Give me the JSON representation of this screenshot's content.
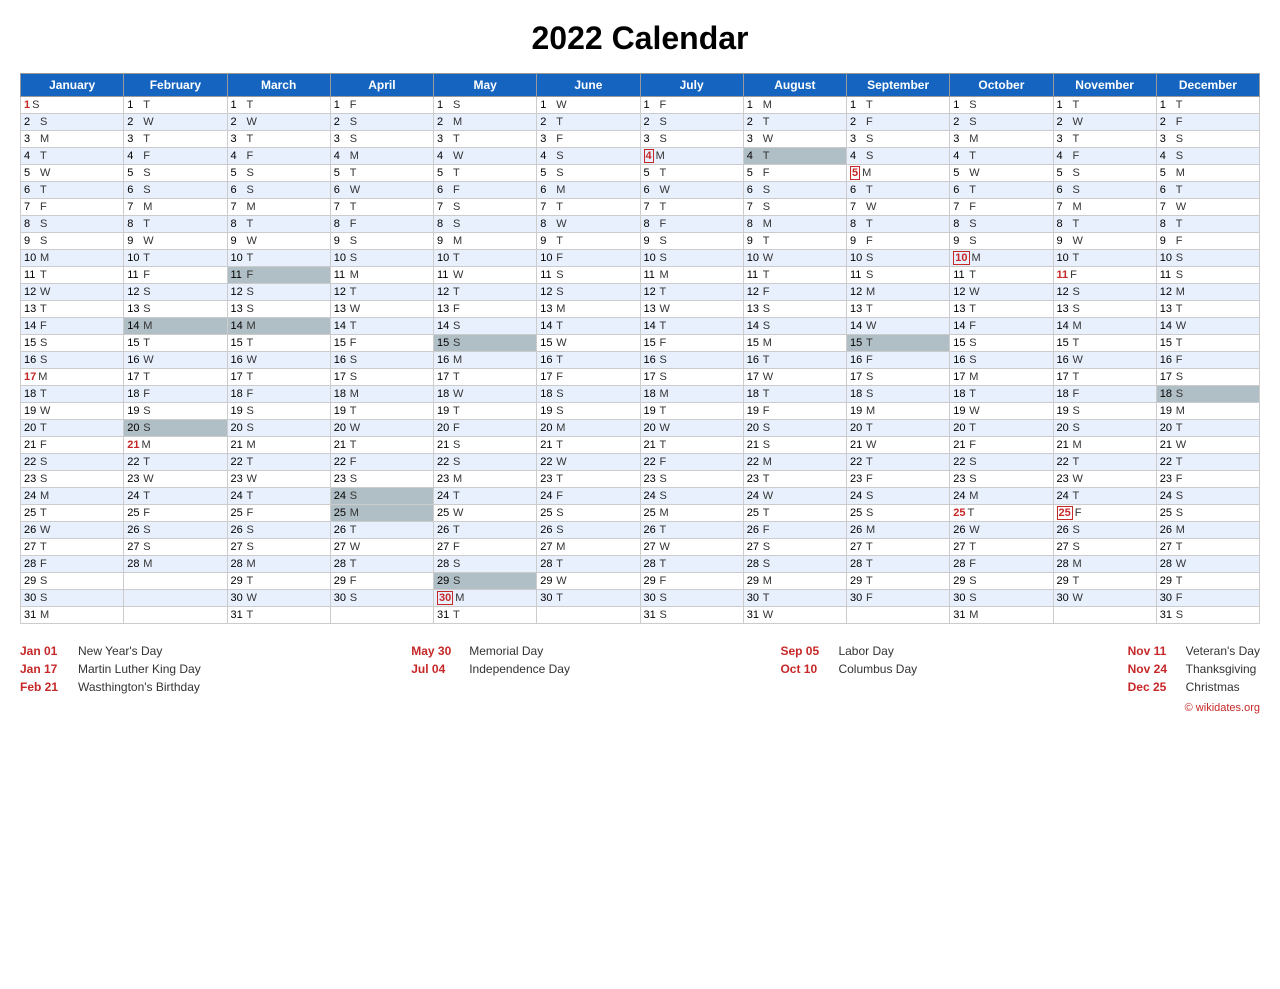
{
  "title": "2022 Calendar",
  "months": [
    "January",
    "February",
    "March",
    "April",
    "May",
    "June",
    "July",
    "August",
    "September",
    "October",
    "November",
    "December"
  ],
  "rows": [
    [
      "1 S",
      "1 T",
      "1 T",
      "1 F",
      "1 S",
      "1 W",
      "1 F",
      "1 M",
      "1 T",
      "1 S",
      "1 T",
      "1 T"
    ],
    [
      "2 S",
      "2 W",
      "2 W",
      "2 S",
      "2 M",
      "2 T",
      "2 S",
      "2 T",
      "2 F",
      "2 S",
      "2 W",
      "2 F"
    ],
    [
      "3 M",
      "3 T",
      "3 T",
      "3 S",
      "3 T",
      "3 F",
      "3 S",
      "3 W",
      "3 S",
      "3 M",
      "3 T",
      "3 S"
    ],
    [
      "4 T",
      "4 F",
      "4 F",
      "4 M",
      "4 W",
      "4 S",
      "4 M",
      "4 T",
      "4 S",
      "4 T",
      "4 F",
      "4 S"
    ],
    [
      "5 W",
      "5 S",
      "5 S",
      "5 T",
      "5 T",
      "5 S",
      "5 T",
      "5 F",
      "5 M",
      "5 W",
      "5 S",
      "5 M"
    ],
    [
      "6 T",
      "6 S",
      "6 S",
      "6 W",
      "6 F",
      "6 M",
      "6 W",
      "6 S",
      "6 T",
      "6 T",
      "6 S",
      "6 T"
    ],
    [
      "7 F",
      "7 M",
      "7 M",
      "7 T",
      "7 S",
      "7 T",
      "7 T",
      "7 S",
      "7 W",
      "7 F",
      "7 M",
      "7 W"
    ],
    [
      "8 S",
      "8 T",
      "8 T",
      "8 F",
      "8 S",
      "8 W",
      "8 F",
      "8 M",
      "8 T",
      "8 S",
      "8 T",
      "8 T"
    ],
    [
      "9 S",
      "9 W",
      "9 W",
      "9 S",
      "9 M",
      "9 T",
      "9 S",
      "9 T",
      "9 F",
      "9 S",
      "9 W",
      "9 F"
    ],
    [
      "10 M",
      "10 T",
      "10 T",
      "10 S",
      "10 T",
      "10 F",
      "10 S",
      "10 W",
      "10 S",
      "10 M",
      "10 T",
      "10 S"
    ],
    [
      "11 T",
      "11 F",
      "11 F",
      "11 M",
      "11 W",
      "11 S",
      "11 M",
      "11 T",
      "11 S",
      "11 T",
      "11 F",
      "11 S"
    ],
    [
      "12 W",
      "12 S",
      "12 S",
      "12 T",
      "12 T",
      "12 S",
      "12 T",
      "12 F",
      "12 M",
      "12 W",
      "12 S",
      "12 M"
    ],
    [
      "13 T",
      "13 S",
      "13 S",
      "13 W",
      "13 F",
      "13 M",
      "13 W",
      "13 S",
      "13 T",
      "13 T",
      "13 S",
      "13 T"
    ],
    [
      "14 F",
      "14 M",
      "14 M",
      "14 T",
      "14 S",
      "14 T",
      "14 T",
      "14 S",
      "14 W",
      "14 F",
      "14 M",
      "14 W"
    ],
    [
      "15 S",
      "15 T",
      "15 T",
      "15 F",
      "15 S",
      "15 W",
      "15 F",
      "15 M",
      "15 T",
      "15 S",
      "15 T",
      "15 T"
    ],
    [
      "16 S",
      "16 W",
      "16 W",
      "16 S",
      "16 M",
      "16 T",
      "16 S",
      "16 T",
      "16 F",
      "16 S",
      "16 W",
      "16 F"
    ],
    [
      "17 M",
      "17 T",
      "17 T",
      "17 S",
      "17 T",
      "17 F",
      "17 S",
      "17 W",
      "17 S",
      "17 M",
      "17 T",
      "17 S"
    ],
    [
      "18 T",
      "18 F",
      "18 F",
      "18 M",
      "18 W",
      "18 S",
      "18 M",
      "18 T",
      "18 S",
      "18 T",
      "18 F",
      "18 S"
    ],
    [
      "19 W",
      "19 S",
      "19 S",
      "19 T",
      "19 T",
      "19 S",
      "19 T",
      "19 F",
      "19 M",
      "19 W",
      "19 S",
      "19 M"
    ],
    [
      "20 T",
      "20 S",
      "20 S",
      "20 W",
      "20 F",
      "20 M",
      "20 W",
      "20 S",
      "20 T",
      "20 T",
      "20 S",
      "20 T"
    ],
    [
      "21 F",
      "21 M",
      "21 M",
      "21 T",
      "21 S",
      "21 T",
      "21 T",
      "21 S",
      "21 W",
      "21 F",
      "21 M",
      "21 W"
    ],
    [
      "22 S",
      "22 T",
      "22 T",
      "22 F",
      "22 S",
      "22 W",
      "22 F",
      "22 M",
      "22 T",
      "22 S",
      "22 T",
      "22 T"
    ],
    [
      "23 S",
      "23 W",
      "23 W",
      "23 S",
      "23 M",
      "23 T",
      "23 S",
      "23 T",
      "23 F",
      "23 S",
      "23 W",
      "23 F"
    ],
    [
      "24 M",
      "24 T",
      "24 T",
      "24 S",
      "24 T",
      "24 F",
      "24 S",
      "24 W",
      "24 S",
      "24 M",
      "24 T",
      "24 S"
    ],
    [
      "25 T",
      "25 F",
      "25 F",
      "25 M",
      "25 W",
      "25 S",
      "25 M",
      "25 T",
      "25 S",
      "25 T",
      "25 F",
      "25 S"
    ],
    [
      "26 W",
      "26 S",
      "26 S",
      "26 T",
      "26 T",
      "26 S",
      "26 T",
      "26 F",
      "26 M",
      "26 W",
      "26 S",
      "26 M"
    ],
    [
      "27 T",
      "27 S",
      "27 S",
      "27 W",
      "27 F",
      "27 M",
      "27 W",
      "27 S",
      "27 T",
      "27 T",
      "27 S",
      "27 T"
    ],
    [
      "28 F",
      "28 M",
      "28 M",
      "28 T",
      "28 S",
      "28 T",
      "28 T",
      "28 S",
      "28 T",
      "28 F",
      "28 M",
      "28 W"
    ],
    [
      "29 S",
      "",
      "29 T",
      "29 F",
      "29 S",
      "29 W",
      "29 F",
      "29 M",
      "29 T",
      "29 S",
      "29 T",
      "29 T"
    ],
    [
      "30 S",
      "",
      "30 W",
      "30 S",
      "30 M",
      "30 T",
      "30 S",
      "30 T",
      "30 F",
      "30 S",
      "30 W",
      "30 F"
    ],
    [
      "31 M",
      "",
      "31 T",
      "",
      "31 T",
      "",
      "31 S",
      "31 W",
      "",
      "31 M",
      "",
      "31 S"
    ]
  ],
  "special_cells": {
    "red_num": [
      "r0c0",
      "r16c0",
      "r20c1",
      "r0c5",
      "r10c10",
      "r24c9",
      "r24c10"
    ],
    "red_box": [
      "r3c6",
      "r4c8",
      "r9c9",
      "r29c4"
    ],
    "shaded": [
      "r3c7",
      "r10c2",
      "r13c1",
      "r13c2",
      "r14c4",
      "r14c8",
      "r17c11",
      "r19c1",
      "r23c3",
      "r24c3",
      "r28c4"
    ]
  },
  "holidays": {
    "col1": [
      {
        "date": "Jan 01",
        "name": "New Year's Day"
      },
      {
        "date": "Jan 17",
        "name": "Martin Luther King Day"
      },
      {
        "date": "Feb 21",
        "name": "Wasthington's Birthday"
      }
    ],
    "col2": [
      {
        "date": "May 30",
        "name": "Memorial Day"
      },
      {
        "date": "Jul 04",
        "name": "Independence Day"
      }
    ],
    "col3": [
      {
        "date": "Sep 05",
        "name": "Labor Day"
      },
      {
        "date": "Oct 10",
        "name": "Columbus Day"
      }
    ],
    "col4": [
      {
        "date": "Nov 11",
        "name": "Veteran's Day"
      },
      {
        "date": "Nov 24",
        "name": "Thanksgiving"
      },
      {
        "date": "Dec 25",
        "name": "Christmas"
      }
    ]
  },
  "footer": "© wikidates.org"
}
